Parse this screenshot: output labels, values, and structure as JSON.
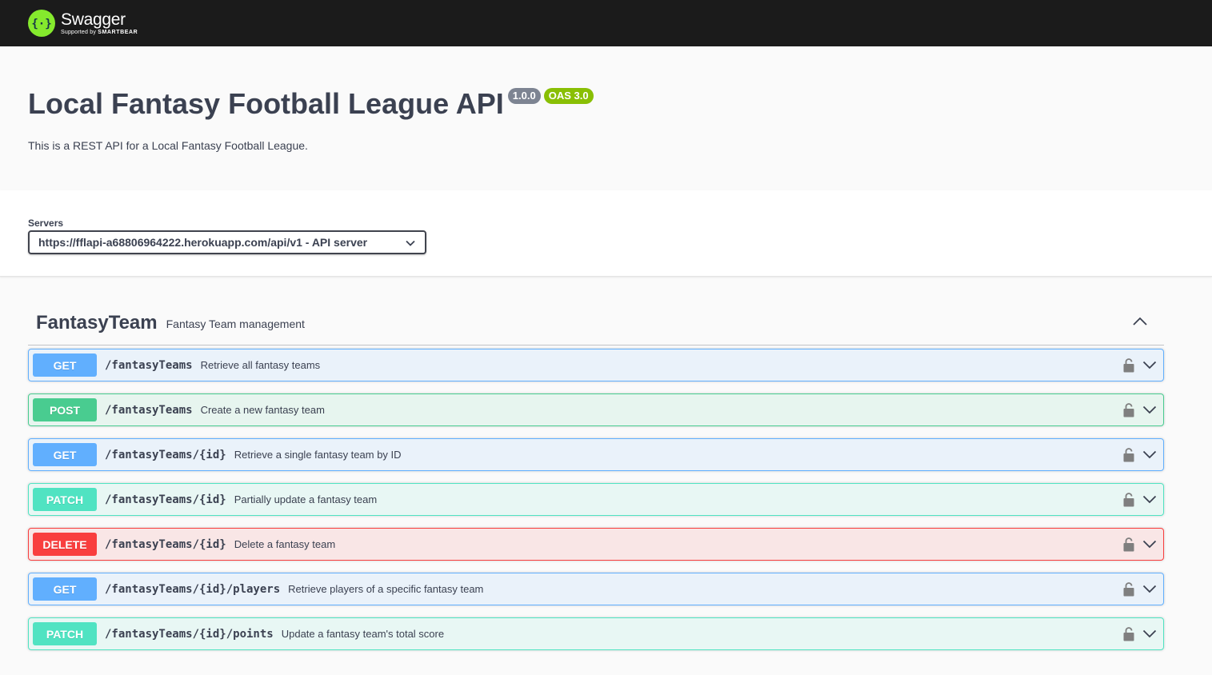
{
  "topbar": {
    "logo_name": "Swagger",
    "logo_sub_prefix": "Supported by",
    "logo_sub_brand": "SMARTBEAR",
    "logo_icon": "swagger-braces-icon",
    "logo_color": "#85ea2d"
  },
  "info": {
    "title": "Local Fantasy Football League API",
    "version": "1.0.0",
    "oas": "OAS 3.0",
    "description": "This is a REST API for a Local Fantasy Football League."
  },
  "servers": {
    "label": "Servers",
    "selected": "https://fflapi-a68806964222.herokuapp.com/api/v1 - API server"
  },
  "tag": {
    "name": "FantasyTeam",
    "description": "Fantasy Team management",
    "expanded": true
  },
  "operations": [
    {
      "method": "GET",
      "path": "/fantasyTeams",
      "summary": "Retrieve all fantasy teams"
    },
    {
      "method": "POST",
      "path": "/fantasyTeams",
      "summary": "Create a new fantasy team"
    },
    {
      "method": "GET",
      "path": "/fantasyTeams/{id}",
      "summary": "Retrieve a single fantasy team by ID"
    },
    {
      "method": "PATCH",
      "path": "/fantasyTeams/{id}",
      "summary": "Partially update a fantasy team"
    },
    {
      "method": "DELETE",
      "path": "/fantasyTeams/{id}",
      "summary": "Delete a fantasy team"
    },
    {
      "method": "GET",
      "path": "/fantasyTeams/{id}/players",
      "summary": "Retrieve players of a specific fantasy team"
    },
    {
      "method": "PATCH",
      "path": "/fantasyTeams/{id}/points",
      "summary": "Update a fantasy team's total score"
    }
  ],
  "colors": {
    "get": "#61affe",
    "post": "#49cc90",
    "patch": "#50e3c2",
    "delete": "#f93e3e",
    "version_badge": "#7d8492",
    "oas_badge": "#89bf04"
  }
}
